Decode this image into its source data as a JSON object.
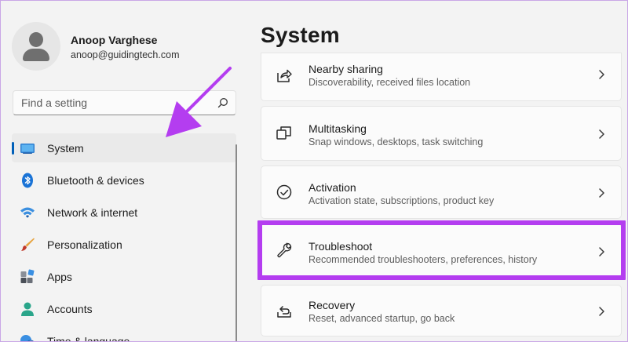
{
  "user": {
    "name": "Anoop Varghese",
    "email": "anoop@guidingtech.com"
  },
  "search": {
    "placeholder": "Find a setting"
  },
  "sidebar": {
    "items": [
      {
        "label": "System",
        "icon": "system-monitor-icon",
        "active": true
      },
      {
        "label": "Bluetooth & devices",
        "icon": "bluetooth-icon"
      },
      {
        "label": "Network & internet",
        "icon": "wifi-icon"
      },
      {
        "label": "Personalization",
        "icon": "brush-icon"
      },
      {
        "label": "Apps",
        "icon": "apps-icon"
      },
      {
        "label": "Accounts",
        "icon": "person-icon"
      },
      {
        "label": "Time & language",
        "icon": "globe-clock-icon"
      }
    ]
  },
  "main": {
    "title": "System",
    "cards": [
      {
        "title": "Nearby sharing",
        "subtitle": "Discoverability, received files location",
        "icon": "share-icon"
      },
      {
        "title": "Multitasking",
        "subtitle": "Snap windows, desktops, task switching",
        "icon": "multitasking-icon"
      },
      {
        "title": "Activation",
        "subtitle": "Activation state, subscriptions, product key",
        "icon": "check-circle-icon"
      },
      {
        "title": "Troubleshoot",
        "subtitle": "Recommended troubleshooters, preferences, history",
        "icon": "wrench-icon",
        "highlighted": true
      },
      {
        "title": "Recovery",
        "subtitle": "Reset, advanced startup, go back",
        "icon": "recovery-icon"
      }
    ]
  },
  "colors": {
    "accent": "#005fb8",
    "annotation": "#b43df0",
    "background": "#f3f3f3",
    "card": "#fbfbfb"
  }
}
